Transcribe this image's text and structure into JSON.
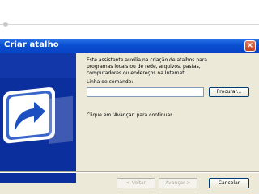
{
  "window": {
    "title": "Criar atalho",
    "close_label": "×"
  },
  "wizard": {
    "intro_lines": [
      "Este assistente auxilia na criação de atalhos para",
      "programas locais ou de rede, arquivos, pastas,",
      "computadores ou endereços na Internet."
    ],
    "command_label": "Linha de comando:",
    "command_value": "",
    "browse_label": "Procurar...",
    "continue_text": "Clique em 'Avançar' para continuar."
  },
  "buttons": {
    "back_label": "< Voltar",
    "next_label": "Avançar >",
    "cancel_label": "Cancelar"
  },
  "icons": {
    "shortcut_graphic": "shortcut-arrow-icon",
    "close": "close-icon"
  },
  "colors": {
    "titlebar": "#0a4fd1",
    "wizard_panel": "#0c2f9e",
    "dialog_bg": "#ece9d8"
  }
}
